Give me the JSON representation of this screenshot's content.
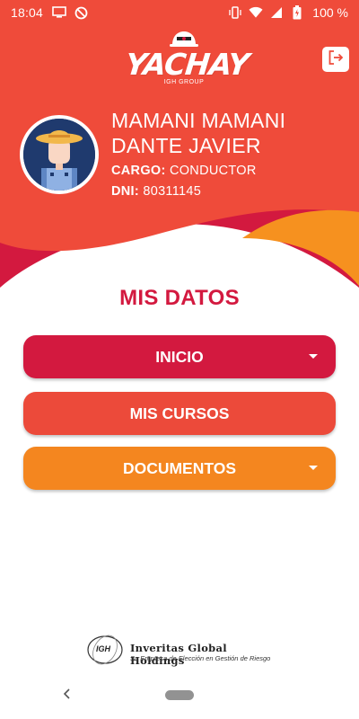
{
  "status_bar": {
    "time": "18:04",
    "battery": "100 %",
    "icons_left": [
      "screen-icon",
      "do-not-disturb-icon"
    ],
    "icons_right": [
      "vibrate-icon",
      "wifi-icon",
      "signal-icon",
      "battery-icon"
    ]
  },
  "header": {
    "logo_text": "YACHAY",
    "logo_subtext": "IGH GROUP",
    "logout_icon": "logout-icon"
  },
  "profile": {
    "name_line1": "MAMANI MAMANI",
    "name_line2": "DANTE JAVIER",
    "cargo_label": "CARGO:",
    "cargo_value": "CONDUCTOR",
    "dni_label": "DNI:",
    "dni_value": "80311145"
  },
  "section": {
    "title": "MIS DATOS"
  },
  "menu": [
    {
      "label": "INICIO",
      "has_dropdown": true,
      "color": "#d3193f"
    },
    {
      "label": "MIS CURSOS",
      "has_dropdown": false,
      "color": "#ec4a3a"
    },
    {
      "label": "DOCUMENTOS",
      "has_dropdown": true,
      "color": "#f4861f"
    }
  ],
  "footer": {
    "company": "Inveritas Global Holdings",
    "tagline": "Su Empresa de Elección en Gestión de Riesgo",
    "badge_text": "IGH"
  },
  "colors": {
    "primary_red": "#d3193f",
    "header_orange_red": "#ec4a3a",
    "accent_orange": "#f4861f",
    "avatar_bg": "#1f3a6e"
  }
}
